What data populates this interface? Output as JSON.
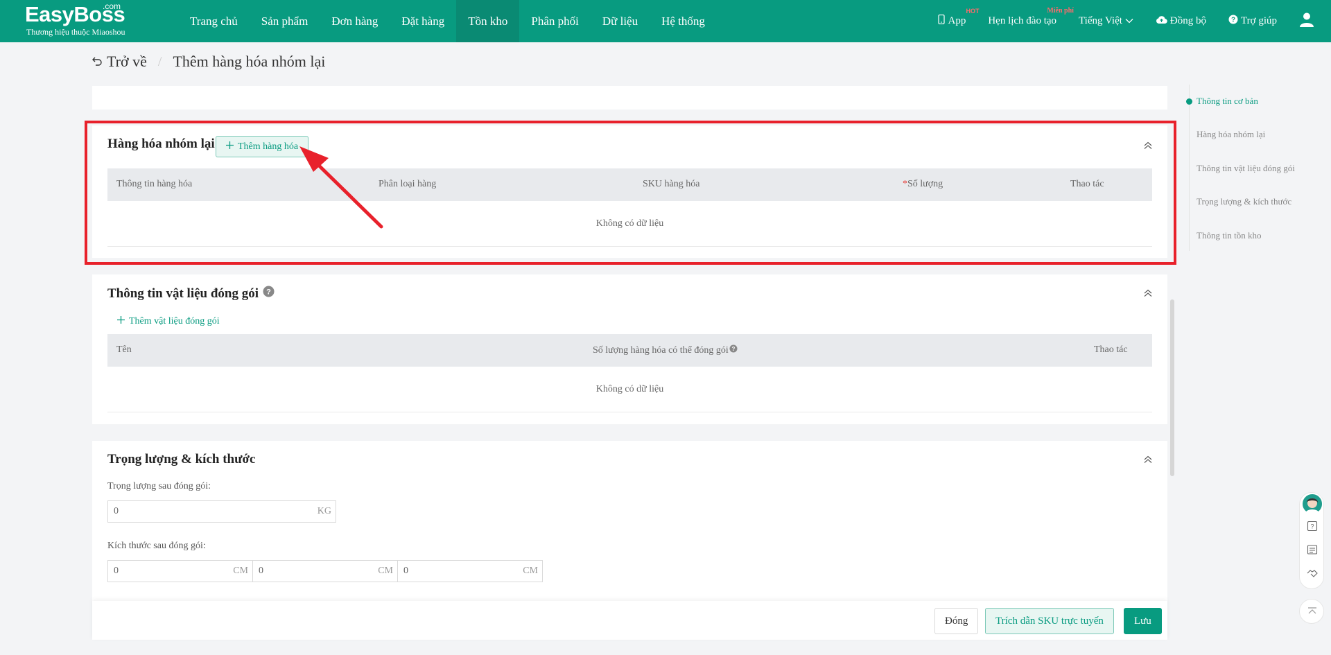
{
  "header": {
    "logo_text": "EasyBoss",
    "logo_com": ".com",
    "logo_sub": "Thương hiệu thuộc Miaoshou",
    "nav": [
      {
        "label": "Trang chủ",
        "active": false
      },
      {
        "label": "Sản phẩm",
        "active": false
      },
      {
        "label": "Đơn hàng",
        "active": false
      },
      {
        "label": "Đặt hàng",
        "active": false
      },
      {
        "label": "Tồn kho",
        "active": true
      },
      {
        "label": "Phân phối",
        "active": false
      },
      {
        "label": "Dữ liệu",
        "active": false
      },
      {
        "label": "Hệ thống",
        "active": false
      }
    ],
    "app_label": "App",
    "app_badge": "HOT",
    "training_label": "Hẹn lịch đào tạo",
    "training_badge": "Miễn phí",
    "language_label": "Tiếng Việt",
    "sync_label": "Đồng bộ",
    "help_label": "Trợ giúp"
  },
  "breadcrumb": {
    "back_label": "Trở về",
    "separator": "/",
    "current": "Thêm hàng hóa nhóm lại"
  },
  "group_panel": {
    "title": "Hàng hóa nhóm lại",
    "add_button": "Thêm hàng hóa",
    "columns": [
      "Thông tin hàng hóa",
      "Phân loại hàng",
      "SKU hàng hóa",
      "Số lượng",
      "Thao tác"
    ],
    "required_mark": "*",
    "empty_text": "Không có dữ liệu"
  },
  "packaging_panel": {
    "title": "Thông tin vật liệu đóng gói",
    "add_link": "Thêm vật liệu đóng gói",
    "columns": [
      "Tên",
      "Số lượng hàng hóa có thể đóng gói",
      "Thao tác"
    ],
    "empty_text": "Không có dữ liệu"
  },
  "weight_panel": {
    "title": "Trọng lượng & kích thước",
    "weight_label": "Trọng lượng sau đóng gói:",
    "weight_value": "0",
    "weight_unit": "KG",
    "size_label": "Kích thước sau đóng gói:",
    "size_values": [
      "0",
      "0",
      "0"
    ],
    "size_unit": "CM"
  },
  "anchor_nav": [
    {
      "label": "Thông tin cơ bản",
      "active": true
    },
    {
      "label": "Hàng hóa nhóm lại",
      "active": false
    },
    {
      "label": "Thông tin vật liệu đóng gói",
      "active": false
    },
    {
      "label": "Trọng lượng & kích thước",
      "active": false
    },
    {
      "label": "Thông tin tồn kho",
      "active": false
    }
  ],
  "footer": {
    "close_button": "Đóng",
    "cite_button": "Trích dẫn SKU trực tuyến",
    "save_button": "Lưu"
  },
  "colors": {
    "primary": "#089b80",
    "highlight": "#e8212b"
  }
}
